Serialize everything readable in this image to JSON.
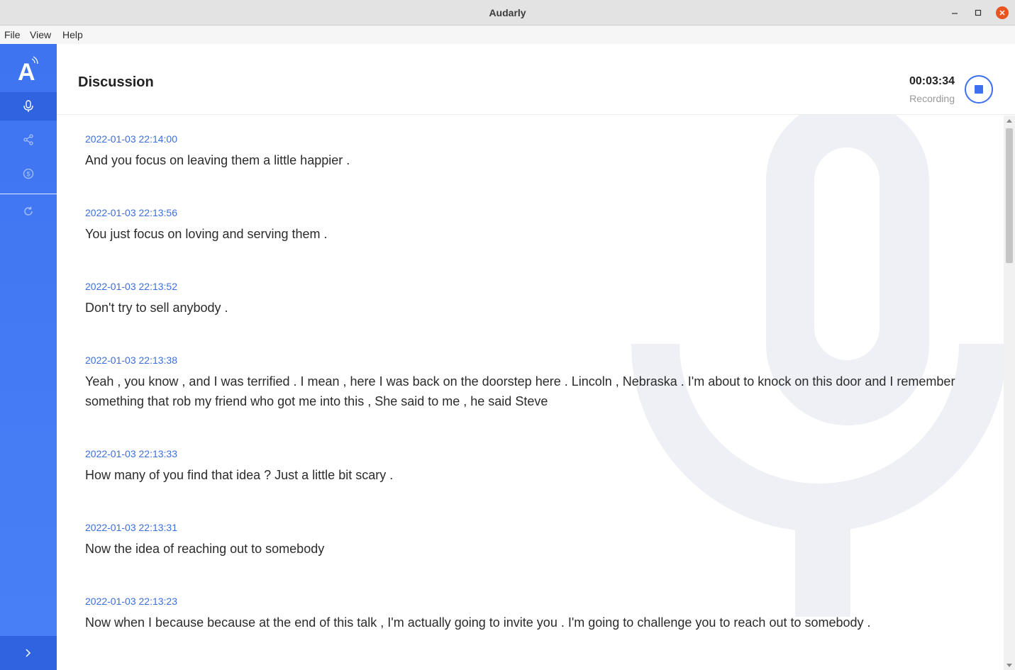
{
  "window": {
    "title": "Audarly"
  },
  "menu": {
    "file": "File",
    "view": "View",
    "help": "Help"
  },
  "sidebar": {
    "logo": "A",
    "items": [
      {
        "icon": "microphone-icon",
        "active": true
      },
      {
        "icon": "share-icon",
        "active": false
      },
      {
        "icon": "dollar-icon",
        "active": false
      },
      {
        "icon": "refresh-icon",
        "active": false
      }
    ],
    "expand_icon": "chevron-right-icon"
  },
  "header": {
    "title": "Discussion",
    "timer": "00:03:34",
    "status": "Recording"
  },
  "colors": {
    "accent": "#3e6ff0",
    "sidebar": "#4178f2",
    "watermark": "#eef0f5",
    "timestamp": "#3d6ee0"
  },
  "transcript": [
    {
      "time": "2022-01-03 22:14:00",
      "text": "And you focus on leaving them a little happier ."
    },
    {
      "time": "2022-01-03 22:13:56",
      "text": "You just focus on loving and serving them ."
    },
    {
      "time": "2022-01-03 22:13:52",
      "text": "Don't try to sell anybody ."
    },
    {
      "time": "2022-01-03 22:13:38",
      "text": "Yeah , you know , and I was terrified . I mean , here I was back on the doorstep here . Lincoln , Nebraska . I'm about to knock on this door and I remember something that rob my friend who got me into this , She said to me , he said Steve"
    },
    {
      "time": "2022-01-03 22:13:33",
      "text": "How many of you find that idea ? Just a little bit scary ."
    },
    {
      "time": "2022-01-03 22:13:31",
      "text": "Now the idea of reaching out to somebody"
    },
    {
      "time": "2022-01-03 22:13:23",
      "text": "Now when I because because at the end of this talk , I'm actually going to invite you . I'm going to challenge you to reach out to somebody ."
    }
  ]
}
